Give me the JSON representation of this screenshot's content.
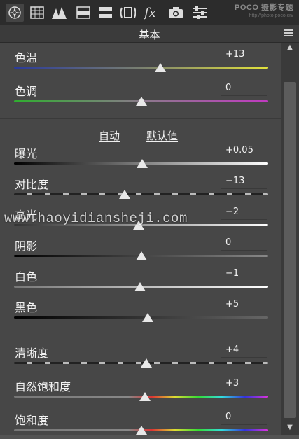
{
  "toolbar": {
    "icons": [
      "basic-panel-icon",
      "tone-curve-icon",
      "detail-icon",
      "hsl-icon",
      "split-toning-icon",
      "lens-icon",
      "effects-icon",
      "camera-calibration-icon",
      "presets-icon"
    ],
    "brand": "POCO 摄影专题",
    "brand_url": "http://photo.poco.cn/"
  },
  "panel": {
    "title": "基本",
    "auto_label": "自动",
    "default_label": "默认值"
  },
  "sliders": {
    "temperature": {
      "label": "色温",
      "value": "+13",
      "fraction": 0.575
    },
    "tint": {
      "label": "色调",
      "value": "0",
      "fraction": 0.5
    },
    "exposure": {
      "label": "曝光",
      "value": "+0.05",
      "fraction": 0.505
    },
    "contrast": {
      "label": "对比度",
      "value": "−13",
      "fraction": 0.435
    },
    "highlights": {
      "label": "高光",
      "value": "−2",
      "fraction": 0.49
    },
    "shadows": {
      "label": "阴影",
      "value": "0",
      "fraction": 0.5
    },
    "whites": {
      "label": "白色",
      "value": "−1",
      "fraction": 0.495
    },
    "blacks": {
      "label": "黑色",
      "value": "+5",
      "fraction": 0.525
    },
    "clarity": {
      "label": "清晰度",
      "value": "+4",
      "fraction": 0.52
    },
    "vibrance": {
      "label": "自然饱和度",
      "value": "+3",
      "fraction": 0.515
    },
    "saturation": {
      "label": "饱和度",
      "value": "0",
      "fraction": 0.5
    }
  },
  "overlay_watermark": "www.haoyidiansheji.com",
  "colors": {
    "temp_track": [
      "#2a3a9a",
      "#e3e33c"
    ],
    "tint_track": [
      "#2fae2f",
      "#c13ac1"
    ]
  }
}
